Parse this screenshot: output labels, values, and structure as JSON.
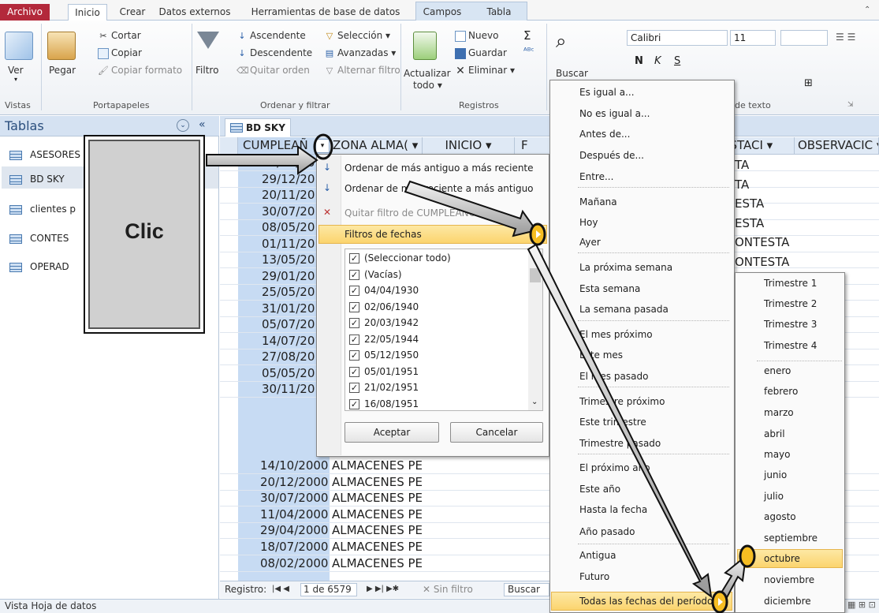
{
  "tabs": {
    "file": "Archivo",
    "items": [
      "Inicio",
      "Crear",
      "Datos externos",
      "Herramientas de base de datos",
      "Campos",
      "Tabla"
    ]
  },
  "ribbon": {
    "vistas": {
      "label": "Vistas",
      "ver": "Ver"
    },
    "portapapeles": {
      "label": "Portapapeles",
      "pegar": "Pegar",
      "cortar": "Cortar",
      "copiar": "Copiar",
      "copiar_formato": "Copiar formato"
    },
    "ordenar": {
      "label": "Ordenar y filtrar",
      "filtro": "Filtro",
      "ascendente": "Ascendente",
      "descendente": "Descendente",
      "quitar_orden": "Quitar orden",
      "seleccion": "Selección ▾",
      "avanzadas": "Avanzadas ▾",
      "alternar": "Alternar filtro"
    },
    "registros": {
      "label": "Registros",
      "actualizar": "Actualizar",
      "todo": "todo ▾",
      "nuevo": "Nuevo",
      "guardar": "Guardar",
      "eliminar": "Eliminar ▾"
    },
    "buscar": {
      "label": "Buscar"
    },
    "texto": {
      "label": "de texto",
      "font": "Calibri",
      "size": "11"
    }
  },
  "nav": {
    "title": "Tablas",
    "items": [
      "ASESORES",
      "BD SKY",
      "clientes p",
      "CONTES",
      "OPERAD"
    ]
  },
  "doc": {
    "tab": "BD SKY",
    "headers": [
      "CUMPLEAÑ",
      "ZONA ALMA(",
      "INICIO",
      "F",
      "ESTACI",
      "OBSERVACIC"
    ]
  },
  "rows": [
    "21/07/20",
    "29/12/20",
    "20/11/20",
    "30/07/20",
    "08/05/20",
    "01/11/20",
    "13/05/20",
    "29/01/20",
    "25/05/20",
    "31/01/20",
    "05/07/20",
    "14/07/20",
    "27/08/20",
    "05/05/20",
    "30/11/20"
  ],
  "rows_full": [
    {
      "d": "14/10/2000",
      "z": "ALMACENES PE"
    },
    {
      "d": "20/12/2000",
      "z": "ALMACENES PE"
    },
    {
      "d": "30/07/2000",
      "z": "ALMACENES PE"
    },
    {
      "d": "11/04/2000",
      "z": "ALMACENES PE"
    },
    {
      "d": "29/04/2000",
      "z": "ALMACENES PE"
    },
    {
      "d": "18/07/2000",
      "z": "ALMACENES PE"
    },
    {
      "d": "08/02/2000",
      "z": "ALMACENES PE"
    }
  ],
  "estaci": [
    "TA",
    "TA",
    "ESTA",
    "ESTA",
    "ONTESTA",
    "ONTESTA"
  ],
  "callout": "Clic",
  "filter_menu": {
    "sort_asc": "Ordenar de más antiguo a más reciente",
    "sort_desc": "Ordenar de más reciente a más antiguo",
    "quitar": "Quitar filtro de CUMPLEAÑOS",
    "filtros_fechas": "Filtros de fechas",
    "checks": [
      "(Seleccionar todo)",
      "(Vacías)",
      "04/04/1930",
      "02/06/1940",
      "20/03/1942",
      "22/05/1944",
      "05/12/1950",
      "05/01/1951",
      "21/02/1951",
      "16/08/1951"
    ],
    "aceptar": "Aceptar",
    "cancelar": "Cancelar"
  },
  "date_menu": [
    "Es igual a...",
    "No es igual a...",
    "Antes de...",
    "Después de...",
    "Entre...",
    "Mañana",
    "Hoy",
    "Ayer",
    "La próxima semana",
    "Esta semana",
    "La semana pasada",
    "El mes próximo",
    "Este mes",
    "El mes pasado",
    "Trimestre próximo",
    "Este trimestre",
    "Trimestre pasado",
    "El próximo año",
    "Este año",
    "Hasta la fecha",
    "Año pasado",
    "Antigua",
    "Futuro",
    "Todas las fechas del período"
  ],
  "period_menu": [
    "Trimestre 1",
    "Trimestre 2",
    "Trimestre 3",
    "Trimestre 4",
    "enero",
    "febrero",
    "marzo",
    "abril",
    "mayo",
    "junio",
    "julio",
    "agosto",
    "septiembre",
    "octubre",
    "noviembre",
    "diciembre"
  ],
  "recnav": {
    "label": "Registro:",
    "pos": "1 de 6579",
    "sinfiltro": "Sin filtro",
    "buscar": "Buscar"
  },
  "status": "Vista Hoja de datos"
}
